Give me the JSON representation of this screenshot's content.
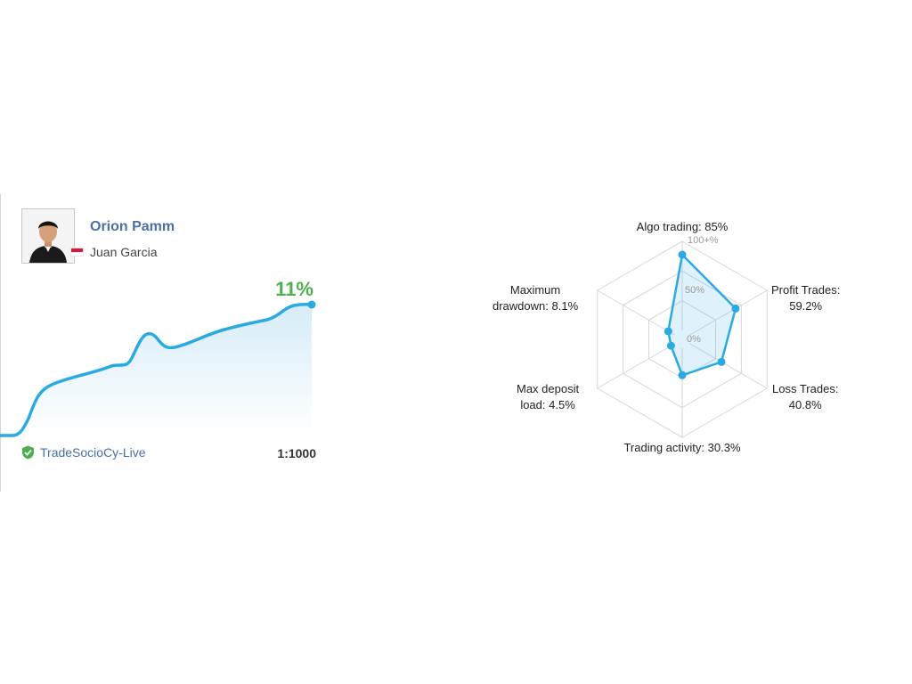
{
  "card": {
    "strategy_name": "Orion Pamm",
    "manager_name": "Juan Garcia",
    "growth": "11%",
    "broker": "TradeSocioCy-Live",
    "leverage": "1:1000",
    "colors": {
      "link": "#4a6fa5",
      "growth": "#4caf50",
      "line": "#29aae1",
      "verified": "#4caf50"
    }
  },
  "radar": {
    "scale_labels": [
      "100+%",
      "50%",
      "0%"
    ],
    "axes": [
      {
        "name": "Algo trading:",
        "value_label": "85%",
        "value": 85
      },
      {
        "name": "Profit Trades:",
        "value_label": "59.2%",
        "value": 59.2
      },
      {
        "name": "Loss Trades:",
        "value_label": "40.8%",
        "value": 40.8
      },
      {
        "name": "Trading activity:",
        "value_label": "30.3%",
        "value": 30.3
      },
      {
        "name": "Max deposit",
        "name2": "load:",
        "value_label": "4.5%",
        "value": 4.5
      },
      {
        "name": "Maximum",
        "name2": "drawdown:",
        "value_label": "8.1%",
        "value": 8.1
      }
    ]
  }
}
